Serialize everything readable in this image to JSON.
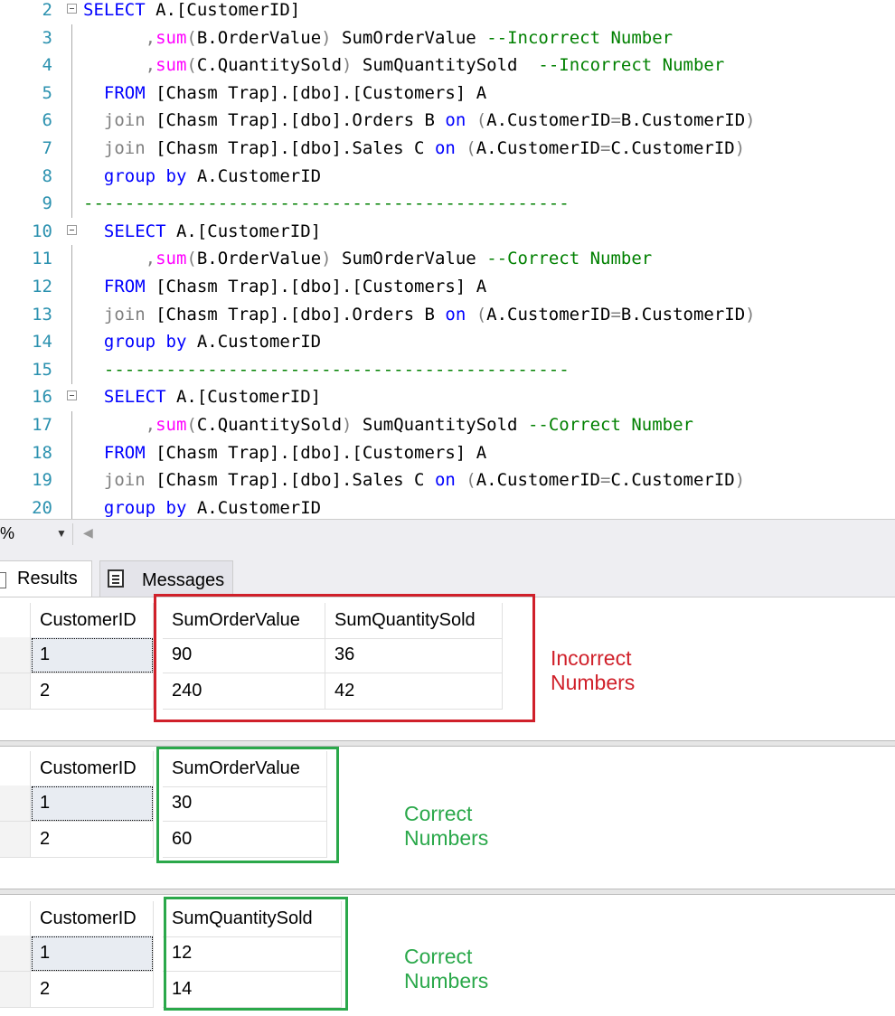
{
  "editor": {
    "lines": [
      {
        "num": "2",
        "fold": true,
        "tokens": [
          {
            "t": "SELECT",
            "c": "kw"
          },
          {
            "t": " A.",
            "c": "id"
          },
          {
            "t": "[CustomerID]",
            "c": "id"
          }
        ]
      },
      {
        "num": "3",
        "tokens": [
          {
            "t": "      ,",
            "c": "op"
          },
          {
            "t": "sum",
            "c": "fn"
          },
          {
            "t": "(",
            "c": "op"
          },
          {
            "t": "B.OrderValue",
            "c": "id"
          },
          {
            "t": ")",
            "c": "op"
          },
          {
            "t": " SumOrderValue ",
            "c": "id"
          },
          {
            "t": "--Incorrect Number",
            "c": "cm"
          }
        ]
      },
      {
        "num": "4",
        "tokens": [
          {
            "t": "      ,",
            "c": "op"
          },
          {
            "t": "sum",
            "c": "fn"
          },
          {
            "t": "(",
            "c": "op"
          },
          {
            "t": "C.QuantitySold",
            "c": "id"
          },
          {
            "t": ")",
            "c": "op"
          },
          {
            "t": " SumQuantitySold  ",
            "c": "id"
          },
          {
            "t": "--Incorrect Number",
            "c": "cm"
          }
        ]
      },
      {
        "num": "5",
        "tokens": [
          {
            "t": "  FROM",
            "c": "kw"
          },
          {
            "t": " [Chasm Trap].[dbo].[Customers] A",
            "c": "id"
          }
        ]
      },
      {
        "num": "6",
        "tokens": [
          {
            "t": "  join",
            "c": "op"
          },
          {
            "t": " [Chasm Trap].[dbo].Orders B ",
            "c": "id"
          },
          {
            "t": "on",
            "c": "kw"
          },
          {
            "t": " (",
            "c": "op"
          },
          {
            "t": "A.CustomerID",
            "c": "id"
          },
          {
            "t": "=",
            "c": "op"
          },
          {
            "t": "B.CustomerID",
            "c": "id"
          },
          {
            "t": ")",
            "c": "op"
          }
        ]
      },
      {
        "num": "7",
        "tokens": [
          {
            "t": "  join",
            "c": "op"
          },
          {
            "t": " [Chasm Trap].[dbo].Sales C ",
            "c": "id"
          },
          {
            "t": "on",
            "c": "kw"
          },
          {
            "t": " (",
            "c": "op"
          },
          {
            "t": "A.CustomerID",
            "c": "id"
          },
          {
            "t": "=",
            "c": "op"
          },
          {
            "t": "C.CustomerID",
            "c": "id"
          },
          {
            "t": ")",
            "c": "op"
          }
        ]
      },
      {
        "num": "8",
        "tokens": [
          {
            "t": "  group by",
            "c": "kw"
          },
          {
            "t": " A.CustomerID",
            "c": "id"
          }
        ]
      },
      {
        "num": "9",
        "tokens": [
          {
            "t": "-----------------------------------------------",
            "c": "cm"
          }
        ]
      },
      {
        "num": "10",
        "fold": true,
        "tokens": [
          {
            "t": "  SELECT",
            "c": "kw"
          },
          {
            "t": " A.[CustomerID]",
            "c": "id"
          }
        ]
      },
      {
        "num": "11",
        "tokens": [
          {
            "t": "      ,",
            "c": "op"
          },
          {
            "t": "sum",
            "c": "fn"
          },
          {
            "t": "(",
            "c": "op"
          },
          {
            "t": "B.OrderValue",
            "c": "id"
          },
          {
            "t": ")",
            "c": "op"
          },
          {
            "t": " SumOrderValue ",
            "c": "id"
          },
          {
            "t": "--Correct Number",
            "c": "cm"
          }
        ]
      },
      {
        "num": "12",
        "tokens": [
          {
            "t": "  FROM",
            "c": "kw"
          },
          {
            "t": " [Chasm Trap].[dbo].[Customers] A",
            "c": "id"
          }
        ]
      },
      {
        "num": "13",
        "tokens": [
          {
            "t": "  join",
            "c": "op"
          },
          {
            "t": " [Chasm Trap].[dbo].Orders B ",
            "c": "id"
          },
          {
            "t": "on",
            "c": "kw"
          },
          {
            "t": " (",
            "c": "op"
          },
          {
            "t": "A.CustomerID",
            "c": "id"
          },
          {
            "t": "=",
            "c": "op"
          },
          {
            "t": "B.CustomerID",
            "c": "id"
          },
          {
            "t": ")",
            "c": "op"
          }
        ]
      },
      {
        "num": "14",
        "tokens": [
          {
            "t": "  group by",
            "c": "kw"
          },
          {
            "t": " A.CustomerID",
            "c": "id"
          }
        ]
      },
      {
        "num": "15",
        "tokens": [
          {
            "t": "  ---------------------------------------------",
            "c": "cm"
          }
        ]
      },
      {
        "num": "16",
        "fold": true,
        "tokens": [
          {
            "t": "  SELECT",
            "c": "kw"
          },
          {
            "t": " A.[CustomerID]",
            "c": "id"
          }
        ]
      },
      {
        "num": "17",
        "tokens": [
          {
            "t": "      ,",
            "c": "op"
          },
          {
            "t": "sum",
            "c": "fn"
          },
          {
            "t": "(",
            "c": "op"
          },
          {
            "t": "C.QuantitySold",
            "c": "id"
          },
          {
            "t": ")",
            "c": "op"
          },
          {
            "t": " SumQuantitySold ",
            "c": "id"
          },
          {
            "t": "--Correct Number",
            "c": "cm"
          }
        ]
      },
      {
        "num": "18",
        "tokens": [
          {
            "t": "  FROM",
            "c": "kw"
          },
          {
            "t": " [Chasm Trap].[dbo].[Customers] A",
            "c": "id"
          }
        ]
      },
      {
        "num": "19",
        "tokens": [
          {
            "t": "  join",
            "c": "op"
          },
          {
            "t": " [Chasm Trap].[dbo].Sales C ",
            "c": "id"
          },
          {
            "t": "on",
            "c": "kw"
          },
          {
            "t": " (",
            "c": "op"
          },
          {
            "t": "A.CustomerID",
            "c": "id"
          },
          {
            "t": "=",
            "c": "op"
          },
          {
            "t": "C.CustomerID",
            "c": "id"
          },
          {
            "t": ")",
            "c": "op"
          }
        ]
      },
      {
        "num": "20",
        "tokens": [
          {
            "t": "  group by",
            "c": "kw"
          },
          {
            "t": " A.CustomerID",
            "c": "id"
          }
        ]
      }
    ]
  },
  "zoom": {
    "value": "%"
  },
  "tabs": {
    "results": "Results",
    "messages": "Messages"
  },
  "results": [
    {
      "columns": [
        "CustomerID",
        "SumOrderValue",
        "SumQuantitySold"
      ],
      "rows": [
        [
          "1",
          "90",
          "36"
        ],
        [
          "2",
          "240",
          "42"
        ]
      ],
      "annotation": "Incorrect Numbers",
      "annotation_color": "#d0202a"
    },
    {
      "columns": [
        "CustomerID",
        "SumOrderValue"
      ],
      "rows": [
        [
          "1",
          "30"
        ],
        [
          "2",
          "60"
        ]
      ],
      "annotation": "Correct Numbers",
      "annotation_color": "#2aa84a"
    },
    {
      "columns": [
        "CustomerID",
        "SumQuantitySold"
      ],
      "rows": [
        [
          "1",
          "12"
        ],
        [
          "2",
          "14"
        ]
      ],
      "annotation": "Correct Numbers",
      "annotation_color": "#2aa84a"
    }
  ]
}
